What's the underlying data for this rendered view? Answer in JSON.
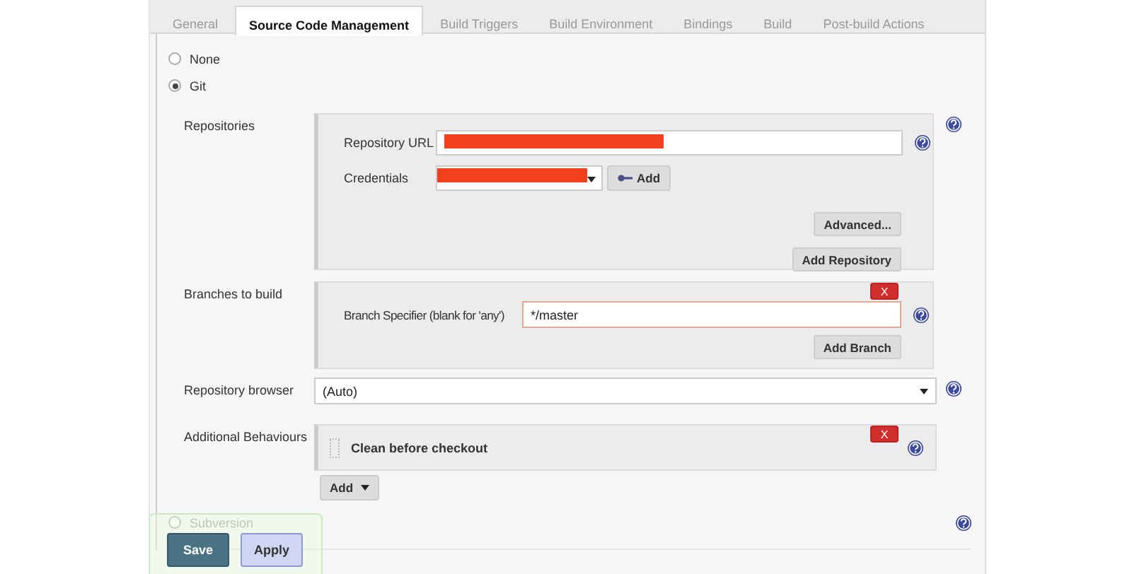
{
  "tabs": [
    {
      "label": "General",
      "selected": false
    },
    {
      "label": "Source Code Management",
      "selected": true
    },
    {
      "label": "Build Triggers",
      "selected": false
    },
    {
      "label": "Build Environment",
      "selected": false
    },
    {
      "label": "Bindings",
      "selected": false
    },
    {
      "label": "Build",
      "selected": false
    },
    {
      "label": "Post-build Actions",
      "selected": false
    }
  ],
  "scm_options": [
    {
      "label": "None",
      "selected": false
    },
    {
      "label": "Git",
      "selected": true
    }
  ],
  "repositories": {
    "label": "Repositories",
    "url_label": "Repository URL",
    "credentials_label": "Credentials",
    "add_credentials_button": "Add",
    "advanced_button": "Advanced...",
    "add_repository_button": "Add Repository"
  },
  "branches": {
    "label": "Branches to build",
    "delete_button": "X",
    "specifier_label": "Branch Specifier (blank for 'any')",
    "specifier_value": "*/master",
    "add_branch_button": "Add Branch"
  },
  "repository_browser": {
    "label": "Repository browser",
    "value": "(Auto)"
  },
  "additional_behaviours": {
    "label": "Additional Behaviours",
    "items": [
      {
        "label": "Clean before checkout",
        "delete_button": "X"
      }
    ],
    "add_button": "Add"
  },
  "other_scm": [
    {
      "label": "Subversion",
      "selected": false
    }
  ],
  "footer_buttons": [
    {
      "label": "Save",
      "kind": "primary"
    },
    {
      "label": "Apply",
      "kind": "secondary"
    }
  ]
}
